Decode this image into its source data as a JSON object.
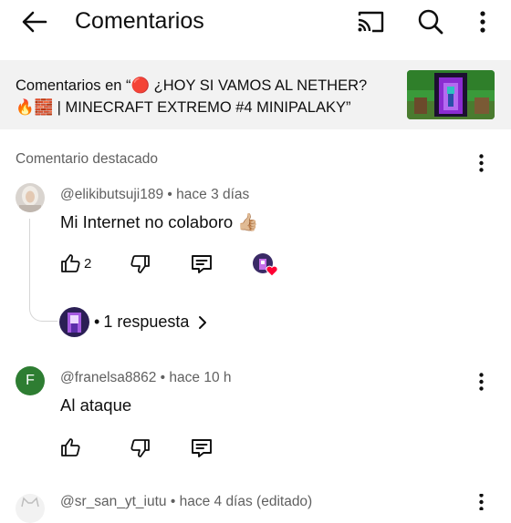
{
  "header": {
    "title": "Comentarios",
    "back_icon": "arrow-left-icon",
    "cast_icon": "cast-icon",
    "search_icon": "search-icon",
    "more_icon": "more-vertical-icon"
  },
  "video_banner": {
    "line1": "Comentarios en “🔴 ¿HOY SI VAMOS AL NETHER?",
    "line2": "🔥🧱 | MINECRAFT EXTREMO #4 MINIPALAKY”"
  },
  "section": {
    "title": "Comentario destacado"
  },
  "comments": [
    {
      "author": "@elikibutsuji189",
      "time": "hace 3 días",
      "text": "Mi Internet no colaboro 👍🏼",
      "likes": "2",
      "replies_label": "1 respuesta"
    },
    {
      "author": "@franelsa8862",
      "time": "hace 10 h",
      "text": "Al ataque",
      "avatar_letter": "F",
      "avatar_color": "#2e7d32"
    },
    {
      "author": "@sr_san_yt_iutu",
      "time": "hace 4 días (editado)"
    }
  ]
}
